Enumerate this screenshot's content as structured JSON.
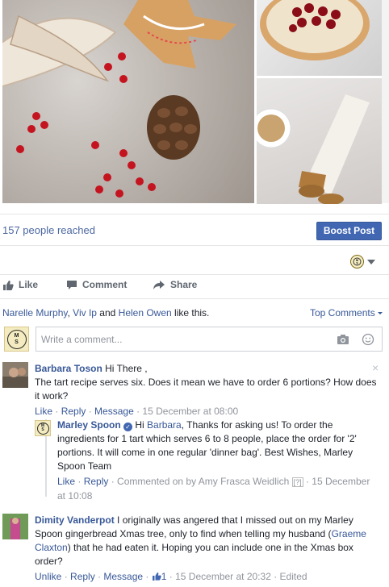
{
  "stats": {
    "reached": "157 people reached",
    "boost": "Boost Post"
  },
  "actions": {
    "like": "Like",
    "comment": "Comment",
    "share": "Share"
  },
  "likes": {
    "names": [
      "Narelle Murphy",
      "Viv Ip",
      "Helen Owen"
    ],
    "sep1": ", ",
    "and": " and ",
    "suffix": " like this.",
    "top_comments": "Top Comments"
  },
  "composer": {
    "placeholder": "Write a comment...",
    "avatar_letters": [
      "M",
      "S"
    ]
  },
  "comments": [
    {
      "name": "Barbara Toson",
      "text": " Hi There ,\nThe tart recipe serves six. Does it mean we have to order 6 portions? How does it work?",
      "like": "Like",
      "reply": "Reply",
      "message": "Message",
      "time": "15 December at 08:00",
      "close": "×"
    },
    {
      "name": "Marley Spoon",
      "verified": "✓",
      "mention": "Barbara",
      "text_before": " Hi ",
      "text_after": ", Thanks for asking us! To order the ingredients for 1 tart which serves 6 to 8 people, place the order for '2' portions. It will come in one regular 'dinner bag'. Best Wishes, Marley Spoon Team",
      "like": "Like",
      "reply": "Reply",
      "commented_on": "Commented on by Amy Frasca Weidlich",
      "q": "[?]",
      "time": "15 December at 10:08"
    },
    {
      "name": "Dimity Vanderpot",
      "text_before": " I originally was angered that I missed out on my Marley Spoon gingerbread Xmas tree, only to find when telling my husband (",
      "mention": "Graeme Claxton",
      "text_after": ") that he had eaten it. Hoping you can include one in the Xmas box order?",
      "unlike": "Unlike",
      "reply": "Reply",
      "message": "Message",
      "like_count": "1",
      "time": "15 December at 20:32",
      "edited": "Edited"
    }
  ],
  "colors": {
    "link": "#385898",
    "boost_bg": "#4267b2",
    "meta": "#90949c"
  }
}
